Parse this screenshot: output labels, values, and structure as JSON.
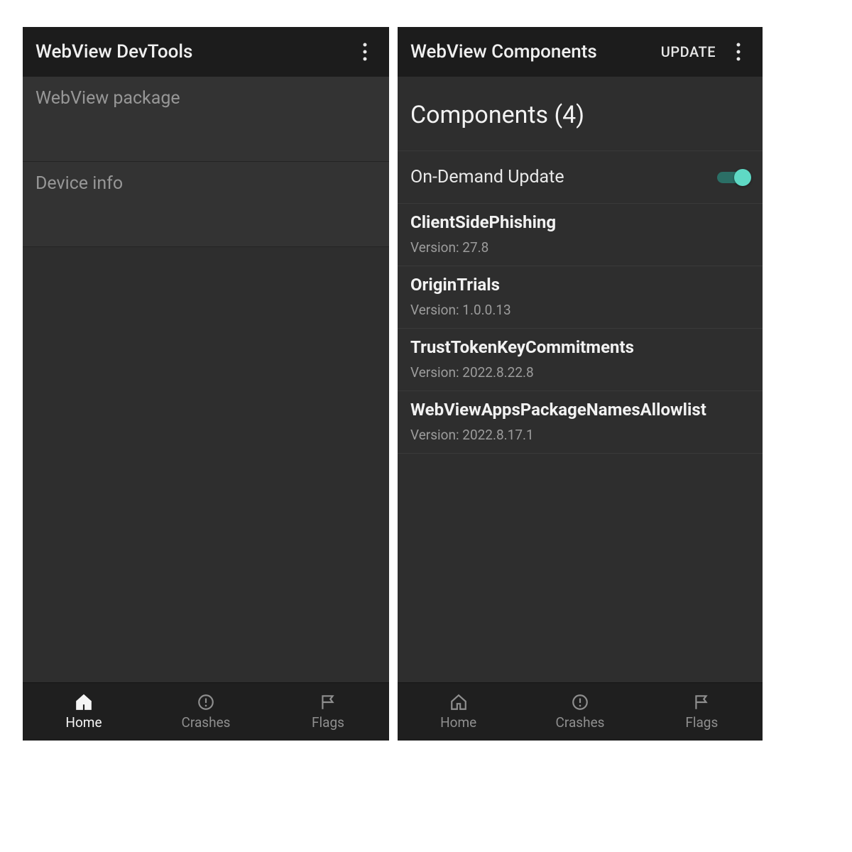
{
  "left": {
    "appbar": {
      "title": "WebView DevTools"
    },
    "sections": [
      {
        "title": "WebView package"
      },
      {
        "title": "Device info"
      }
    ],
    "bottomnav": {
      "items": [
        {
          "label": "Home",
          "icon": "home-icon",
          "active": true
        },
        {
          "label": "Crashes",
          "icon": "alert-icon",
          "active": false
        },
        {
          "label": "Flags",
          "icon": "flag-icon",
          "active": false
        }
      ]
    }
  },
  "right": {
    "appbar": {
      "title": "WebView Components",
      "action": "UPDATE"
    },
    "heading": "Components (4)",
    "toggle": {
      "label": "On-Demand Update",
      "on": true
    },
    "components": [
      {
        "name": "ClientSidePhishing",
        "version": "Version: 27.8"
      },
      {
        "name": "OriginTrials",
        "version": "Version: 1.0.0.13"
      },
      {
        "name": "TrustTokenKeyCommitments",
        "version": "Version: 2022.8.22.8"
      },
      {
        "name": "WebViewAppsPackageNamesAllowlist",
        "version": "Version: 2022.8.17.1"
      }
    ],
    "bottomnav": {
      "items": [
        {
          "label": "Home",
          "icon": "home-icon",
          "active": false
        },
        {
          "label": "Crashes",
          "icon": "alert-icon",
          "active": false
        },
        {
          "label": "Flags",
          "icon": "flag-icon",
          "active": false
        }
      ]
    }
  },
  "colors": {
    "accent": "#5fd9c5",
    "bg": "#2e2e2e",
    "appbar": "#1c1c1c"
  }
}
